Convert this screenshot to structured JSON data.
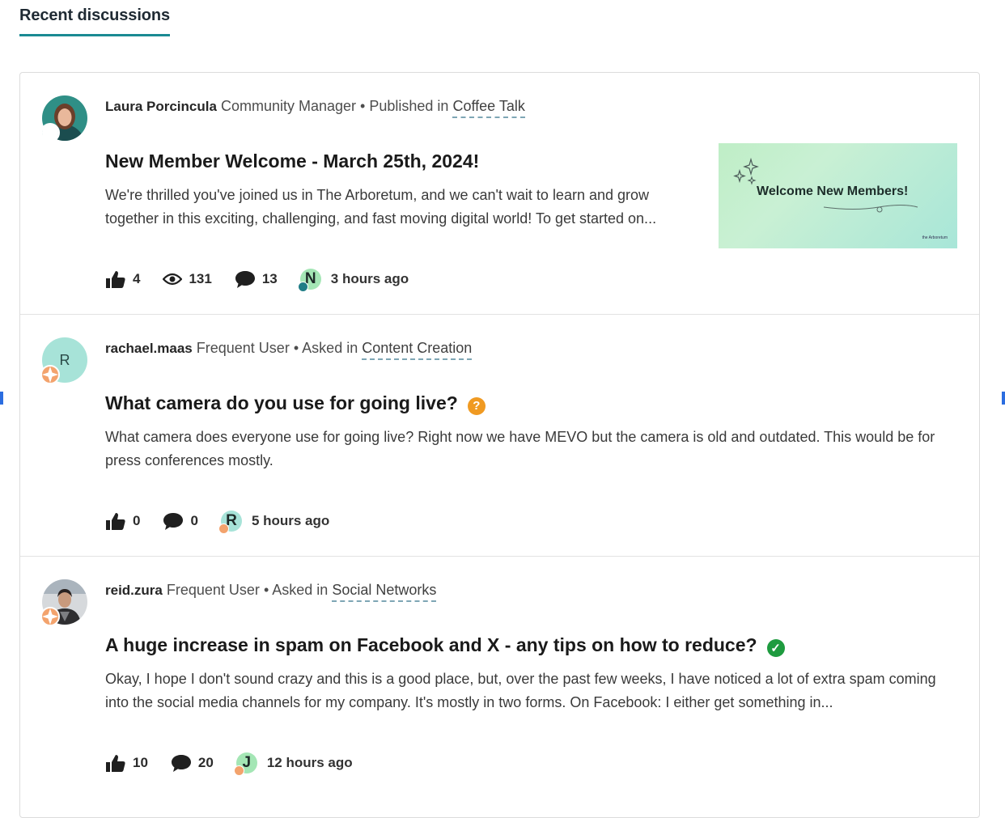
{
  "tabs": {
    "recent_label": "Recent discussions"
  },
  "posts": [
    {
      "author": "Laura Porcincula",
      "role": "Community Manager",
      "action": "Published in",
      "category": "Coffee Talk",
      "title": "New Member Welcome - March 25th, 2024!",
      "excerpt": "We're thrilled you've joined us in The Arboretum, and we can't wait to learn and grow together in this exciting, challenging, and fast moving digital world! To get started on...",
      "thumbnail_text": "Welcome New Members!",
      "thumbnail_footer": "the Arboretum",
      "likes": "4",
      "views": "131",
      "replies": "13",
      "last_reply_initial": "N",
      "time": "3 hours ago"
    },
    {
      "author": "rachael.maas",
      "avatar_initial": "R",
      "role": "Frequent User",
      "action": "Asked in",
      "category": "Content Creation",
      "title": "What camera do you use for going live?",
      "status_badge": "?",
      "excerpt": "What camera does everyone use for going live? Right now we have MEVO but the camera is old and outdated. This would be for press conferences mostly.",
      "likes": "0",
      "replies": "0",
      "last_reply_initial": "R",
      "time": "5 hours ago"
    },
    {
      "author": "reid.zura",
      "role": "Frequent User",
      "action": "Asked in",
      "category": "Social Networks",
      "title": "A huge increase in spam on Facebook and X - any tips on how to reduce?",
      "status_badge": "✓",
      "excerpt": "Okay, I hope I don't sound crazy and this is a good place, but, over the past few weeks, I have noticed a lot of extra spam coming into the social media channels for my company. It's mostly in two forms. On Facebook: I either get something in...",
      "likes": "10",
      "replies": "20",
      "last_reply_initial": "J",
      "time": "12 hours ago"
    }
  ],
  "colors": {
    "accent": "#1a8a93",
    "question_badge": "#f09a22",
    "answered_badge": "#1e9b3f",
    "user_rank": "#f3a36d",
    "manager_rank": "#1f7d86"
  }
}
